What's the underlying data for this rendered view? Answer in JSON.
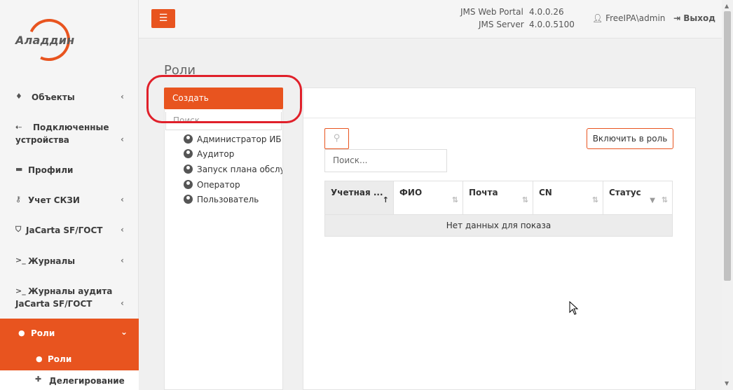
{
  "brand": {
    "logo_text": "Аладдин",
    "accent": "#e8541f"
  },
  "sidebar": {
    "items": [
      {
        "label": "Объекты",
        "icon": "diamond-icon",
        "chevron": "‹"
      },
      {
        "label_line1": "Подключенные",
        "label_line2": "устройства",
        "icon": "usb-icon",
        "chevron": "‹"
      },
      {
        "label": "Профили",
        "icon": "folder-icon"
      },
      {
        "label": "Учет СКЗИ",
        "icon": "key-icon",
        "chevron": "‹"
      },
      {
        "label": "JaCarta SF/ГОСТ",
        "icon": "shield-icon",
        "chevron": "‹"
      },
      {
        "label": "Журналы",
        "icon": "terminal-icon",
        "chevron": "‹"
      },
      {
        "label_line1": "Журналы аудита",
        "label_line2": "JaCarta SF/ГОСТ",
        "icon": "terminal-icon",
        "chevron": "‹"
      },
      {
        "label": "Роли",
        "icon": "user-circle-icon",
        "chevron": "⌄"
      }
    ],
    "sub_items": [
      {
        "label": "Роли",
        "icon": "user-circle-icon"
      },
      {
        "label": "Делегирование",
        "icon": "user-plus-icon"
      }
    ]
  },
  "header": {
    "menu_icon": "☰",
    "portal_label": "JMS Web Portal",
    "portal_version": "4.0.0.26",
    "server_label": "JMS Server",
    "server_version": "4.0.0.5100",
    "user": "FreeIPA\\admin",
    "logout": "Выход"
  },
  "main": {
    "title": "Роли",
    "create_button": "Создать",
    "search_placeholder": "Поиск",
    "roles": [
      "Администратор ИБ",
      "Аудитор",
      "Запуск плана обслуживания",
      "Оператор",
      "Пользователь"
    ],
    "search_field_placeholder": "Поиск...",
    "include_button": "Включить в роль",
    "table": {
      "columns": [
        "Учетная ...",
        "ФИО",
        "Почта",
        "CN",
        "Статус"
      ],
      "empty_text": "Нет данных для показа"
    }
  }
}
